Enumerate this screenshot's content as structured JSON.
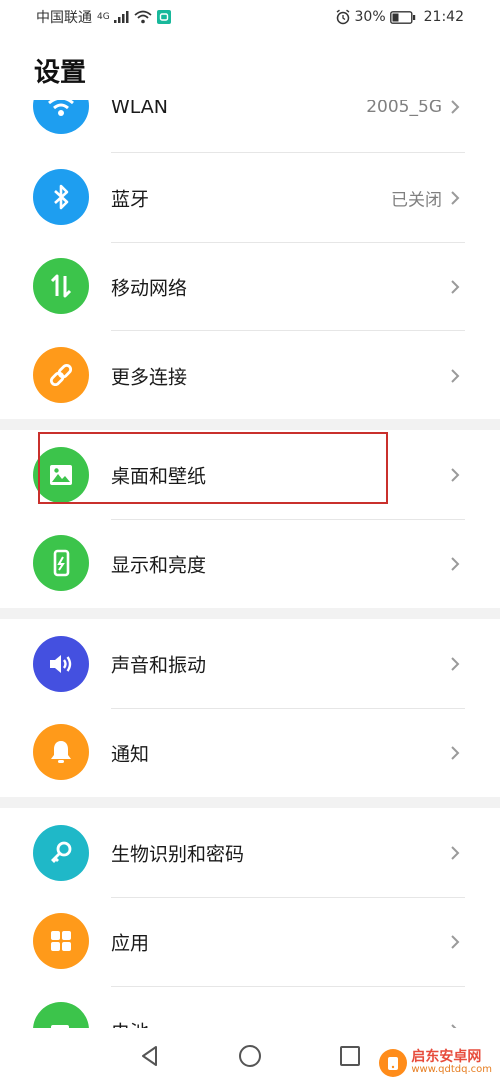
{
  "status_bar": {
    "carrier": "中国联通",
    "network_tag": "4G",
    "battery": "30%",
    "time": "21:42"
  },
  "page_title": "设置",
  "items": [
    {
      "id": "wlan",
      "label": "WLAN",
      "value": "2005_5G",
      "icon": "wifi-icon",
      "color": "#1e9ef0"
    },
    {
      "id": "bluetooth",
      "label": "蓝牙",
      "value": "已关闭",
      "icon": "bluetooth-icon",
      "color": "#1e9ef0"
    },
    {
      "id": "mobile",
      "label": "移动网络",
      "value": "",
      "icon": "transfer-arrows-icon",
      "color": "#3cc44b"
    },
    {
      "id": "more",
      "label": "更多连接",
      "value": "",
      "icon": "link-icon",
      "color": "#ff9a1a"
    },
    {
      "id": "wallpaper",
      "label": "桌面和壁纸",
      "value": "",
      "icon": "image-icon",
      "color": "#3cc44b"
    },
    {
      "id": "display",
      "label": "显示和亮度",
      "value": "",
      "icon": "phone-brightness-icon",
      "color": "#3cc44b"
    },
    {
      "id": "sound",
      "label": "声音和振动",
      "value": "",
      "icon": "speaker-icon",
      "color": "#4450e0"
    },
    {
      "id": "notify",
      "label": "通知",
      "value": "",
      "icon": "bell-icon",
      "color": "#ff9a1a"
    },
    {
      "id": "biometric",
      "label": "生物识别和密码",
      "value": "",
      "icon": "key-icon",
      "color": "#1fb8c8"
    },
    {
      "id": "apps",
      "label": "应用",
      "value": "",
      "icon": "grid-icon",
      "color": "#ff9a1a"
    },
    {
      "id": "battery",
      "label": "电池",
      "value": "",
      "icon": "battery-icon",
      "color": "#3cc44b"
    }
  ],
  "watermark": {
    "name": "启东安卓网",
    "url": "www.qdtdq.com"
  }
}
